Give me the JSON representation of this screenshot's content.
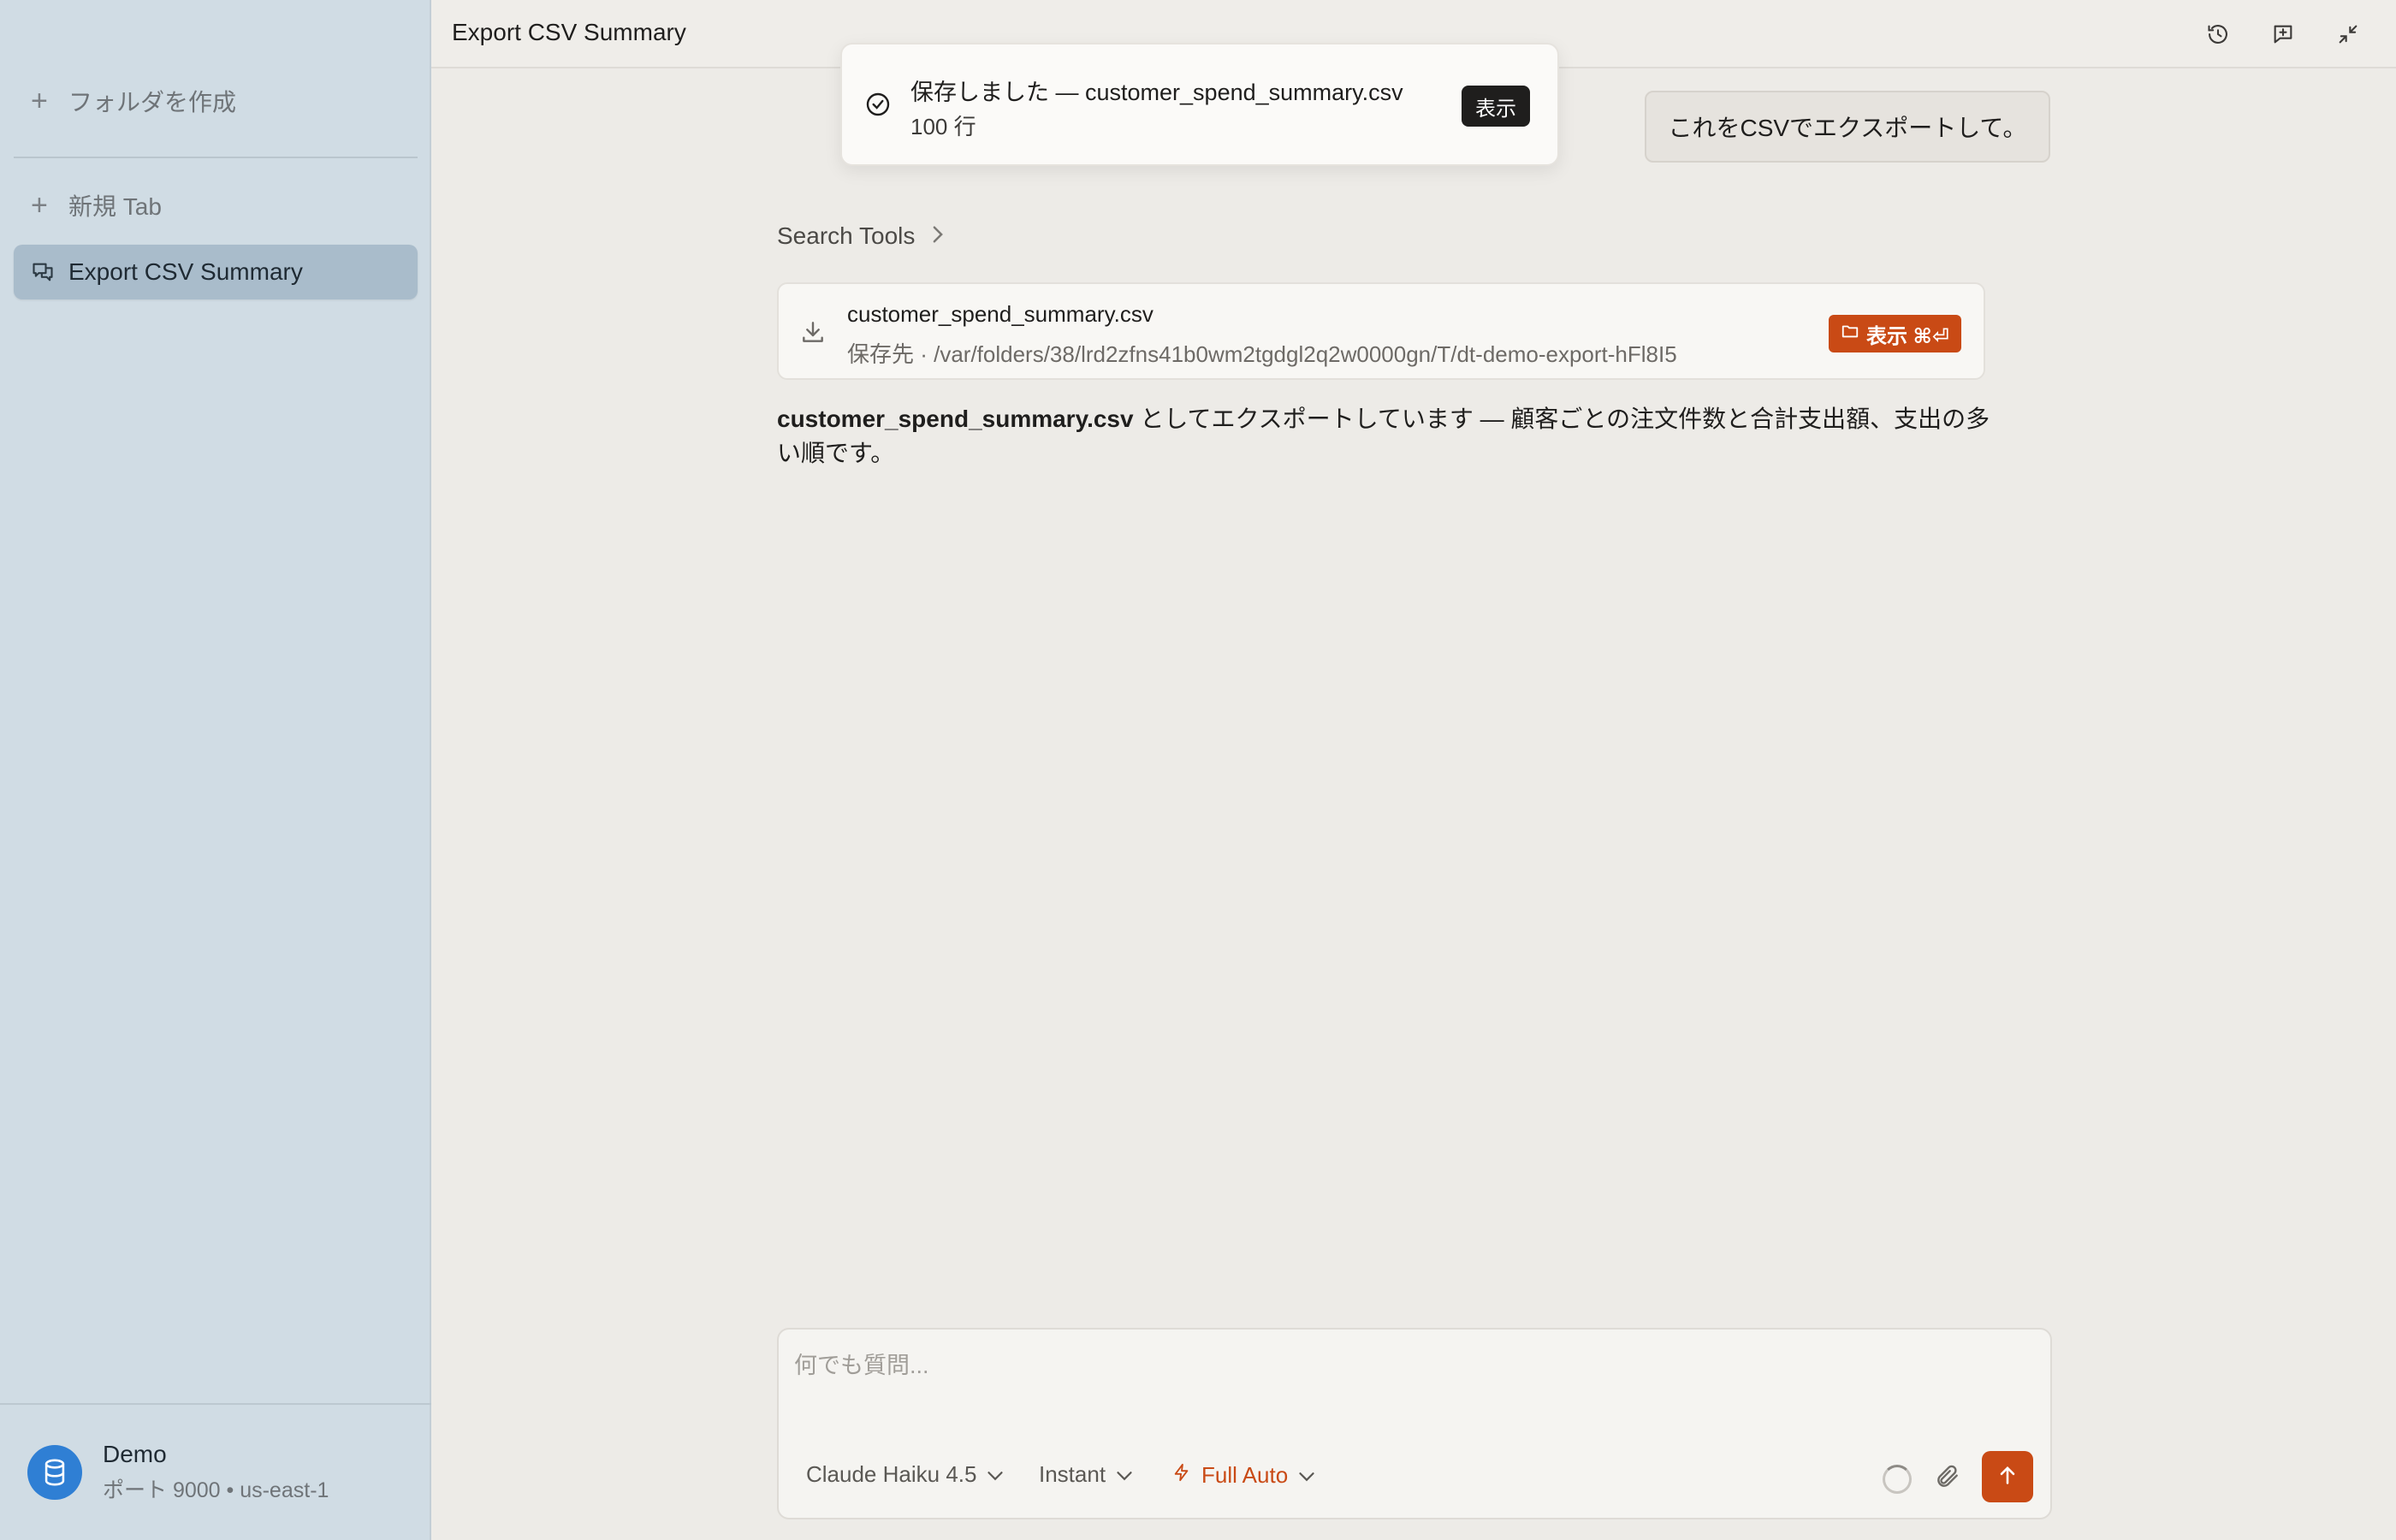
{
  "sidebar": {
    "create_folder": "フォルダを作成",
    "new_tab": "新規 Tab",
    "active_chat": "Export CSV Summary",
    "footer": {
      "name": "Demo",
      "meta": "ポート 9000 • us-east-1"
    }
  },
  "topbar": {
    "title": "Export CSV Summary",
    "icons": [
      "history-icon",
      "new-chat-icon",
      "collapse-icon"
    ]
  },
  "toast": {
    "message": "保存しました — customer_spend_summary.csv",
    "rows": "100 行",
    "button": "表示"
  },
  "conversation": {
    "user_message": "これをCSVでエクスポートして。",
    "search_tools": "Search Tools",
    "file_card": {
      "filename": "customer_spend_summary.csv",
      "path": "保存先 · /var/folders/38/lrd2zfns41b0wm2tgdgl2q2w0000gn/T/dt-demo-export-hFl8I5",
      "button": "表示 ⌘⏎"
    },
    "answer_bold": "customer_spend_summary.csv",
    "answer_rest": " としてエクスポートしています — 顧客ごとの注文件数と合計支出額、支出の多い順です。"
  },
  "composer": {
    "placeholder": "何でも質問...",
    "model": "Claude Haiku 4.5",
    "speed": "Instant",
    "mode": "Full Auto"
  },
  "colors": {
    "accent": "#c94a15",
    "sidebar_bg": "#d0dce4",
    "main_bg": "#edebe7"
  }
}
